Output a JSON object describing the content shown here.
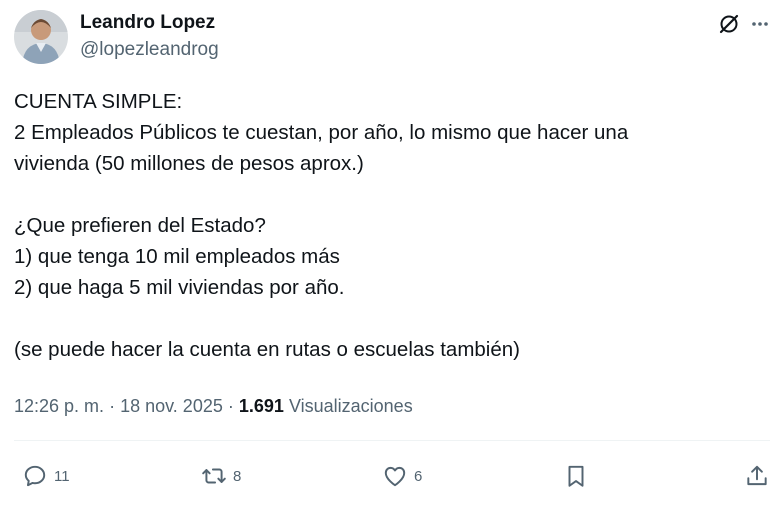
{
  "author": {
    "name": "Leandro Lopez",
    "handle": "@lopezleandrog",
    "avatar_icon": "profile-photo"
  },
  "post": {
    "lines": [
      "CUENTA SIMPLE:",
      "2 Empleados Públicos te cuestan, por año, lo mismo que hacer una",
      "vivienda (50 millones de pesos aprox.)",
      "",
      "¿Que prefieren del Estado?",
      "1) que tenga 10 mil empleados más",
      "2) que haga 5 mil viviendas por año.",
      "",
      "(se puede hacer la cuenta en rutas o escuelas también)"
    ]
  },
  "meta": {
    "time": "12:26 p. m.",
    "separator": "·",
    "date": "18 nov. 2025",
    "views_count": "1.691",
    "views_label": "Visualizaciones"
  },
  "actions": {
    "replies": "11",
    "reposts": "8",
    "likes": "6"
  },
  "colors": {
    "text": "#0f1419",
    "secondary": "#536471",
    "divider": "#eff3f4"
  }
}
